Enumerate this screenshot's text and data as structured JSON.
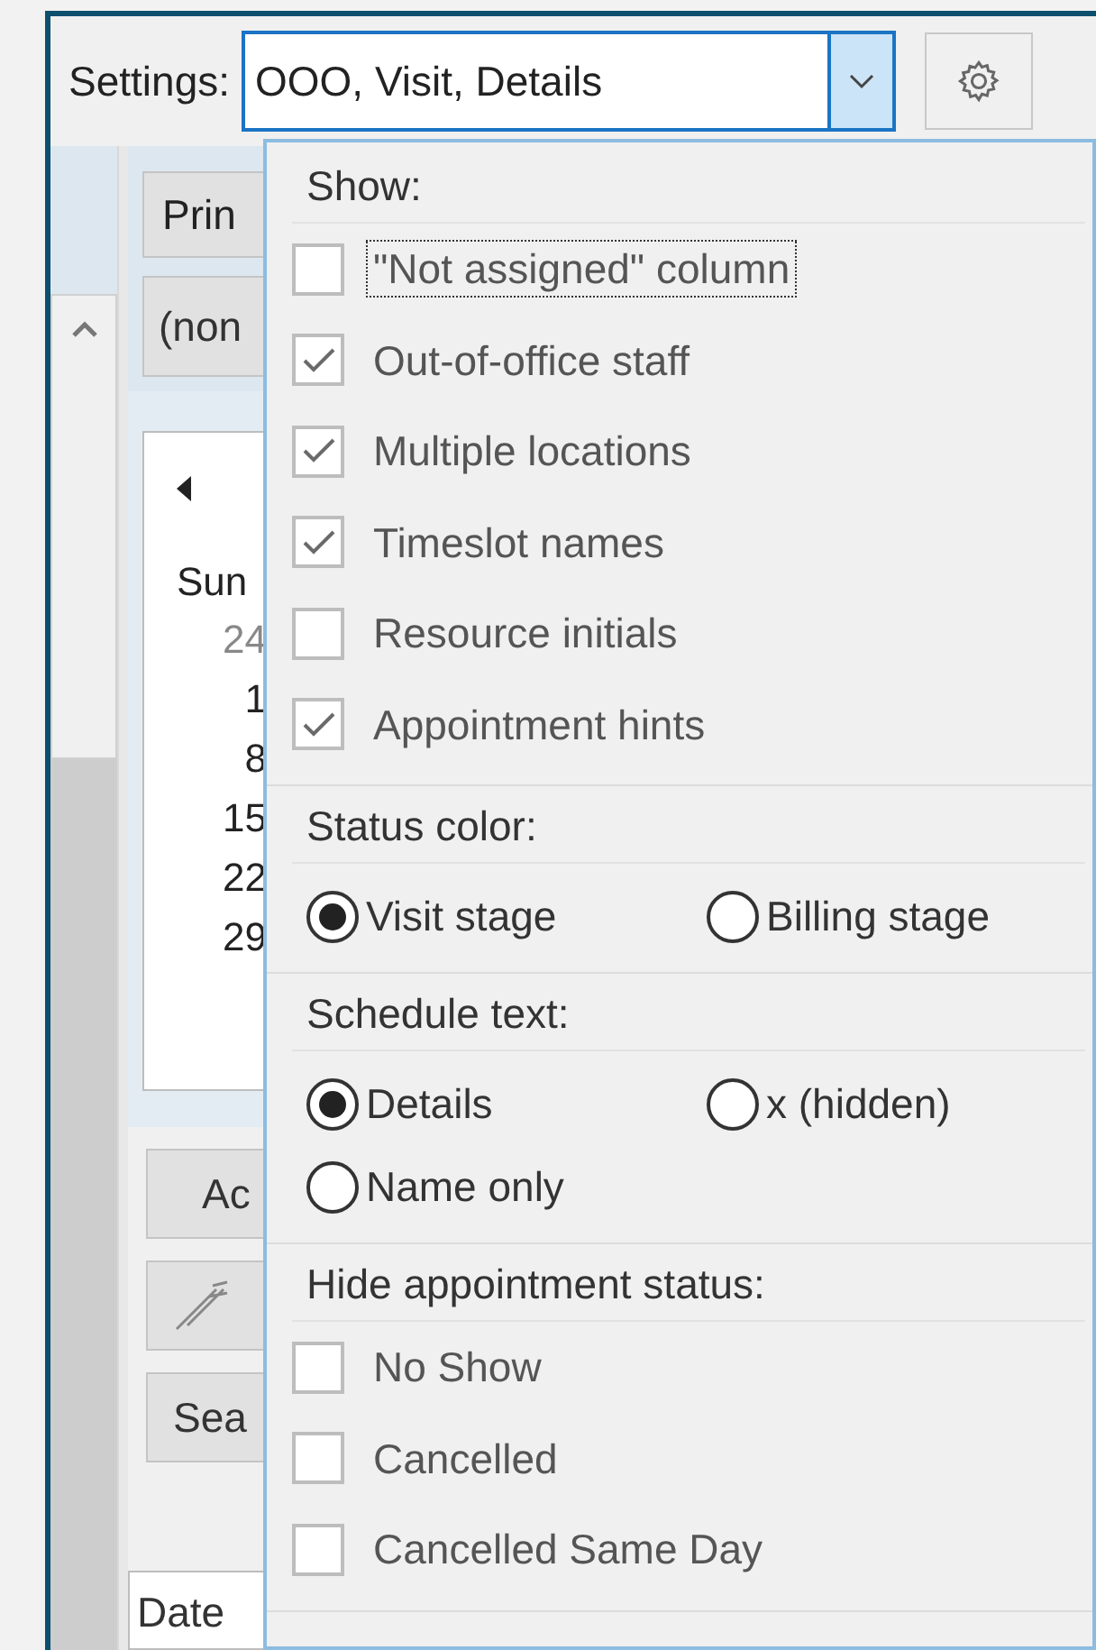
{
  "settings": {
    "label": "Settings:",
    "value": "OOO, Visit, Details"
  },
  "background": {
    "print_button": "Prin",
    "filter_value": "(non",
    "calendar": {
      "weekday": "Sun",
      "dates": [
        "24",
        "1",
        "8",
        "15",
        "22",
        "29"
      ]
    },
    "add_button": "Ac",
    "search_button": "Sea",
    "date_column": "Date"
  },
  "popup": {
    "sections": [
      {
        "kind": "checkboxes",
        "title": "Show:",
        "items": [
          {
            "label": "\"Not assigned\" column",
            "checked": false,
            "focused": true
          },
          {
            "label": "Out-of-office staff",
            "checked": true,
            "focused": false
          },
          {
            "label": "Multiple locations",
            "checked": true,
            "focused": false
          },
          {
            "label": "Timeslot names",
            "checked": true,
            "focused": false
          },
          {
            "label": "Resource initials",
            "checked": false,
            "focused": false
          },
          {
            "label": "Appointment hints",
            "checked": true,
            "focused": false
          }
        ]
      },
      {
        "kind": "radios",
        "title": "Status color:",
        "items": [
          {
            "label": "Visit stage",
            "selected": true
          },
          {
            "label": "Billing stage",
            "selected": false
          }
        ]
      },
      {
        "kind": "radios",
        "title": "Schedule text:",
        "items": [
          {
            "label": "Details",
            "selected": true
          },
          {
            "label": "x (hidden)",
            "selected": false
          },
          {
            "label": "Name only",
            "selected": false
          }
        ]
      },
      {
        "kind": "checkboxes",
        "title": "Hide appointment status:",
        "items": [
          {
            "label": "No Show",
            "checked": false,
            "focused": false
          },
          {
            "label": "Cancelled",
            "checked": false,
            "focused": false
          },
          {
            "label": "Cancelled Same Day",
            "checked": false,
            "focused": false
          }
        ]
      }
    ]
  }
}
